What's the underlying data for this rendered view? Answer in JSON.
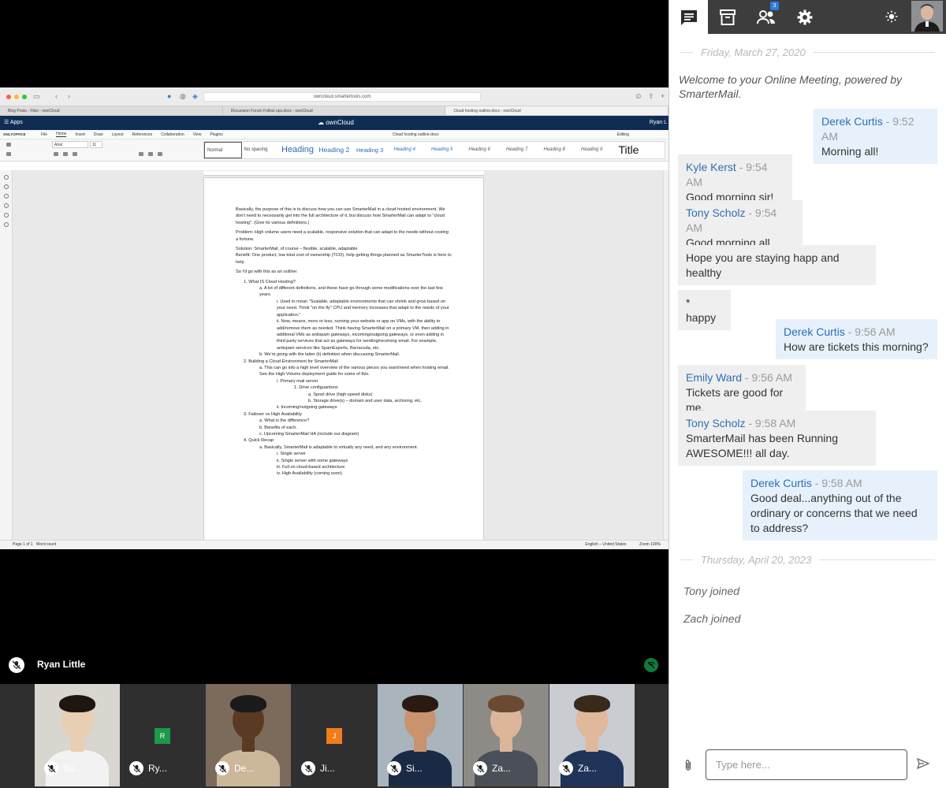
{
  "browser": {
    "url": "owncloud.smartertools.com",
    "tabs": [
      "Blog Posts - Files - ownCloud",
      "Discussion Forum Follow ups.docx - ownCloud",
      "Cloud hosting outline.docx - ownCloud"
    ]
  },
  "owncloud": {
    "apps_label": "Apps",
    "brand": "ownCloud",
    "user": "Ryan L"
  },
  "editor": {
    "logo": "ONLYOFFICE",
    "menu": [
      "File",
      "Home",
      "Insert",
      "Draw",
      "Layout",
      "References",
      "Collaboration",
      "View",
      "Plugins"
    ],
    "doc_title": "Cloud hosting outline.docx",
    "mode": "Editing",
    "font": "Arial",
    "size": "11",
    "styles": [
      "Normal",
      "No spacing",
      "Heading 1",
      "Heading 2",
      "Heading 3",
      "Heading 4",
      "Heading 5",
      "Heading 6",
      "Heading 7",
      "Heading 8",
      "Heading 9",
      "Title"
    ],
    "lines": [
      {
        "c": "p",
        "t": "Basically, the purpose of this is to discuss how you can use SmarterMail in a cloud hosted environment. We don't need to necessarily get into the full architecture of it, but discuss how SmarterMail can adapt to \"cloud hosting\". (Give its various definitions.)"
      },
      {
        "c": "p",
        "t": "Problem: High volume users need a scalable, responsive solution that can adapt to the needs without costing a fortune."
      },
      {
        "c": "",
        "t": "Solution: SmarterMail, of course – flexible, scalable, adaptable"
      },
      {
        "c": "p",
        "t": "Benefit: One product, low total cost of ownership (TCO), help getting things planned as SmarterTools is here to help"
      },
      {
        "c": "p",
        "t": "So I'd go with this as an outline:"
      },
      {
        "c": "l1",
        "t": "1.   What IS Cloud Hosting?"
      },
      {
        "c": "l2",
        "t": "a.   A lot of different definitions, and these have go through some modifications over the last few years."
      },
      {
        "c": "l3",
        "t": "i.    Used to mean \"Scalable, adaptable environments that can shrink and grow based on your need. Think \"on the fly\" CPU and memory increases that adapt to the needs of your application.\""
      },
      {
        "c": "l3",
        "t": "ii.   Now, means, more or less, running your website or app on VMs, with the ability to add/remove them as needed. Think having SmarterMail on a primary VM, then adding in addtional VMs as antispam gateways, incoming/outgoing gateways, or even adding in third party services that act as gateways for sending/receiving email. For example, antispam services like SpamExperts, Barracuda, etc."
      },
      {
        "c": "l2",
        "t": "b.   We're going with the latter (ii) definition when discussing SmarterMail."
      },
      {
        "c": "l1",
        "t": "2.   Building a Cloud Environment for SmarterMail"
      },
      {
        "c": "l2",
        "t": "a.   This can go into a high level overview of the various pieces you want/need when hosting email. See the High Volume deployment guide for some of this."
      },
      {
        "c": "l3",
        "t": "i.    Primary mail server"
      },
      {
        "c": "l4",
        "t": "1.   Drive configuartions"
      },
      {
        "c": "l5",
        "t": "a.   Spool drive (high-speed disks)"
      },
      {
        "c": "l5",
        "t": "b.   Storage drive(s) – domain and user data, archiving, etc."
      },
      {
        "c": "l3",
        "t": "ii.   Incoming/outgoing gateways"
      },
      {
        "c": "l1",
        "t": "3.   Failover vs High Availability"
      },
      {
        "c": "l2",
        "t": "a.   What is the difference?"
      },
      {
        "c": "l2",
        "t": "b.   Benefits of each."
      },
      {
        "c": "l2",
        "t": "c.   Upcoming SmarterMail HA (include our diagram)"
      },
      {
        "c": "l1",
        "t": "4.   Quick Recap"
      },
      {
        "c": "l2",
        "t": "a.   Basically, SmarterMail is adaptable to virtually any need, and any environment."
      },
      {
        "c": "l3",
        "t": "i.    Single server"
      },
      {
        "c": "l3",
        "t": "ii.   Single server with some gateways"
      },
      {
        "c": "l3",
        "t": "iii.  Full on cloud-based architecture"
      },
      {
        "c": "l3",
        "t": "iv.   High Availability (coming soon)"
      }
    ],
    "status_left": "Page 1 of 1",
    "word_count": "Word count",
    "language": "English – United States",
    "zoom": "Zoom 100%"
  },
  "presenter": {
    "name": "Ryan Little"
  },
  "participants": [
    {
      "label": "Sa...",
      "initial": "",
      "color": "",
      "photo": true,
      "tone": "#e8cfb3",
      "bg": "#d9d5cf",
      "shirt": "#f2f2f2",
      "hair": "#1e1612"
    },
    {
      "label": "Ry...",
      "initial": "R",
      "color": "#1c9a4a",
      "photo": false
    },
    {
      "label": "De...",
      "initial": "",
      "color": "",
      "photo": true,
      "tone": "#5b3a24",
      "bg": "#7c6a5a",
      "shirt": "#cdb79a",
      "hair": "#1a1a1a"
    },
    {
      "label": "Ji...",
      "initial": "J",
      "color": "#f07c1c",
      "photo": false
    },
    {
      "label": "Si...",
      "initial": "",
      "color": "",
      "photo": true,
      "tone": "#c8936e",
      "bg": "#a9b4bd",
      "shirt": "#1b2a44",
      "hair": "#2a1a12"
    },
    {
      "label": "Za...",
      "initial": "",
      "color": "",
      "photo": true,
      "tone": "#dcb59a",
      "bg": "#8e8a86",
      "shirt": "#4a4f58",
      "hair": "#6a4a30"
    },
    {
      "label": "Za...",
      "initial": "",
      "color": "",
      "photo": true,
      "tone": "#e0b89a",
      "bg": "#c9ccd0",
      "shirt": "#1f3458",
      "hair": "#3a2a1c"
    }
  ],
  "chat": {
    "badge": "3",
    "day1": "Friday, March 27, 2020",
    "welcome": "Welcome to your Online Meeting, powered by SmarterMail.",
    "messages": [
      {
        "who": "Derek Curtis",
        "time": " - 9:52 AM",
        "text": "Morning all!",
        "out": true
      },
      {
        "who": "Kyle Kerst",
        "time": " - 9:54 AM",
        "text": "Good morning sir!",
        "out": false
      },
      {
        "who": "Tony Scholz",
        "time": " - 9:54 AM",
        "text": "Good morning all",
        "out": false
      },
      {
        "who": "",
        "time": "",
        "text": "Hope you are staying happ and healthy",
        "out": false
      },
      {
        "who": "",
        "time": "",
        "text": "* happy",
        "out": false
      },
      {
        "who": "Derek Curtis",
        "time": " - 9:56 AM",
        "text": "How are tickets this morning?",
        "out": true
      },
      {
        "who": "Emily Ward",
        "time": " - 9:56 AM",
        "text": "Tickets are good for me.",
        "out": false
      },
      {
        "who": "Tony Scholz",
        "time": " - 9:58 AM",
        "text": "SmarterMail has been Running AWESOME!!! all day.",
        "out": false
      },
      {
        "who": "Derek Curtis",
        "time": " - 9:58 AM",
        "text": "Good deal...anything out of the ordinary or concerns that we need to address?",
        "out": true
      }
    ],
    "day2": "Thursday, April 20, 2023",
    "system": [
      "Tony joined",
      "Zach joined"
    ],
    "input_placeholder": "Type here..."
  }
}
